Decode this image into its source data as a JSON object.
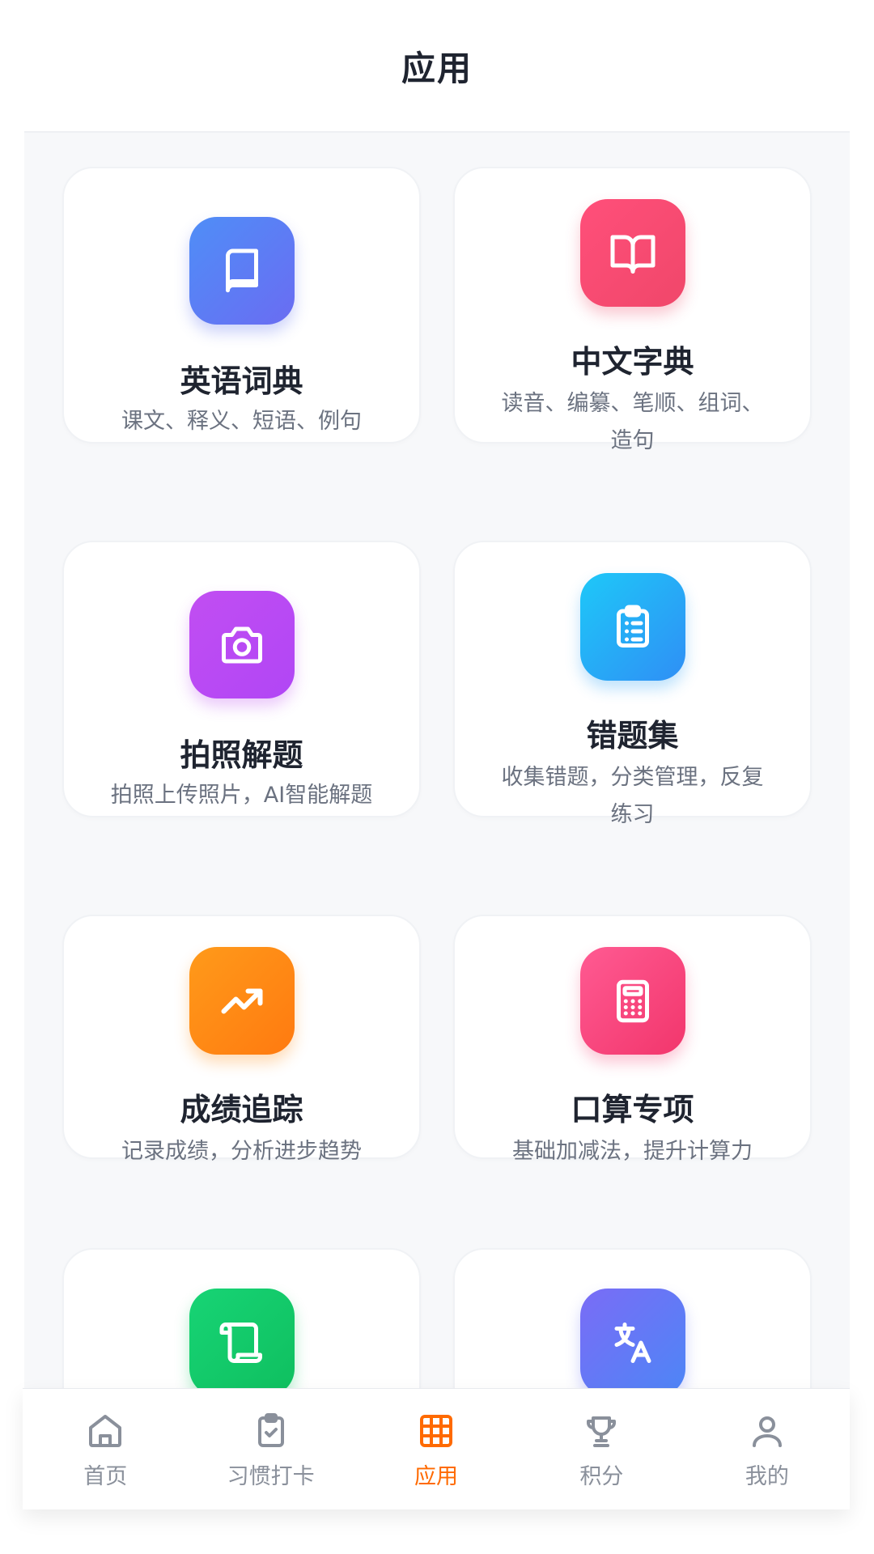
{
  "header": {
    "title": "应用"
  },
  "apps": [
    {
      "name": "英语词典",
      "desc": "课文、释义、短语、例句",
      "icon": "book-icon",
      "color": "#5b7cf6"
    },
    {
      "name": "中文字典",
      "desc": "读音、编纂、笔顺、组词、造句",
      "icon": "open-book-icon",
      "color": "#f54d72"
    },
    {
      "name": "拍照解题",
      "desc": "拍照上传照片，AI智能解题",
      "icon": "camera-icon",
      "color": "#c04cf3"
    },
    {
      "name": "错题集",
      "desc": "收集错题，分类管理，反复练习",
      "icon": "clipboard-list-icon",
      "color": "#22b3f6"
    },
    {
      "name": "成绩追踪",
      "desc": "记录成绩，分析进步趋势",
      "icon": "trending-up-icon",
      "color": "#ff8c16"
    },
    {
      "name": "口算专项",
      "desc": "基础加减法，提升计算力",
      "icon": "calculator-icon",
      "color": "#f84a82"
    },
    {
      "icon": "scroll-icon",
      "color": "#12cc6b"
    },
    {
      "icon": "translate-icon",
      "color": "#6575f6"
    }
  ],
  "tabbar": {
    "active_color": "#ff6a00",
    "inactive_color": "#8a909b",
    "items": [
      {
        "label": "首页",
        "icon": "home-icon"
      },
      {
        "label": "习惯打卡",
        "icon": "clipboard-check-icon"
      },
      {
        "label": "应用",
        "icon": "grid-icon",
        "active": true
      },
      {
        "label": "积分",
        "icon": "trophy-icon"
      },
      {
        "label": "我的",
        "icon": "user-icon"
      }
    ]
  }
}
